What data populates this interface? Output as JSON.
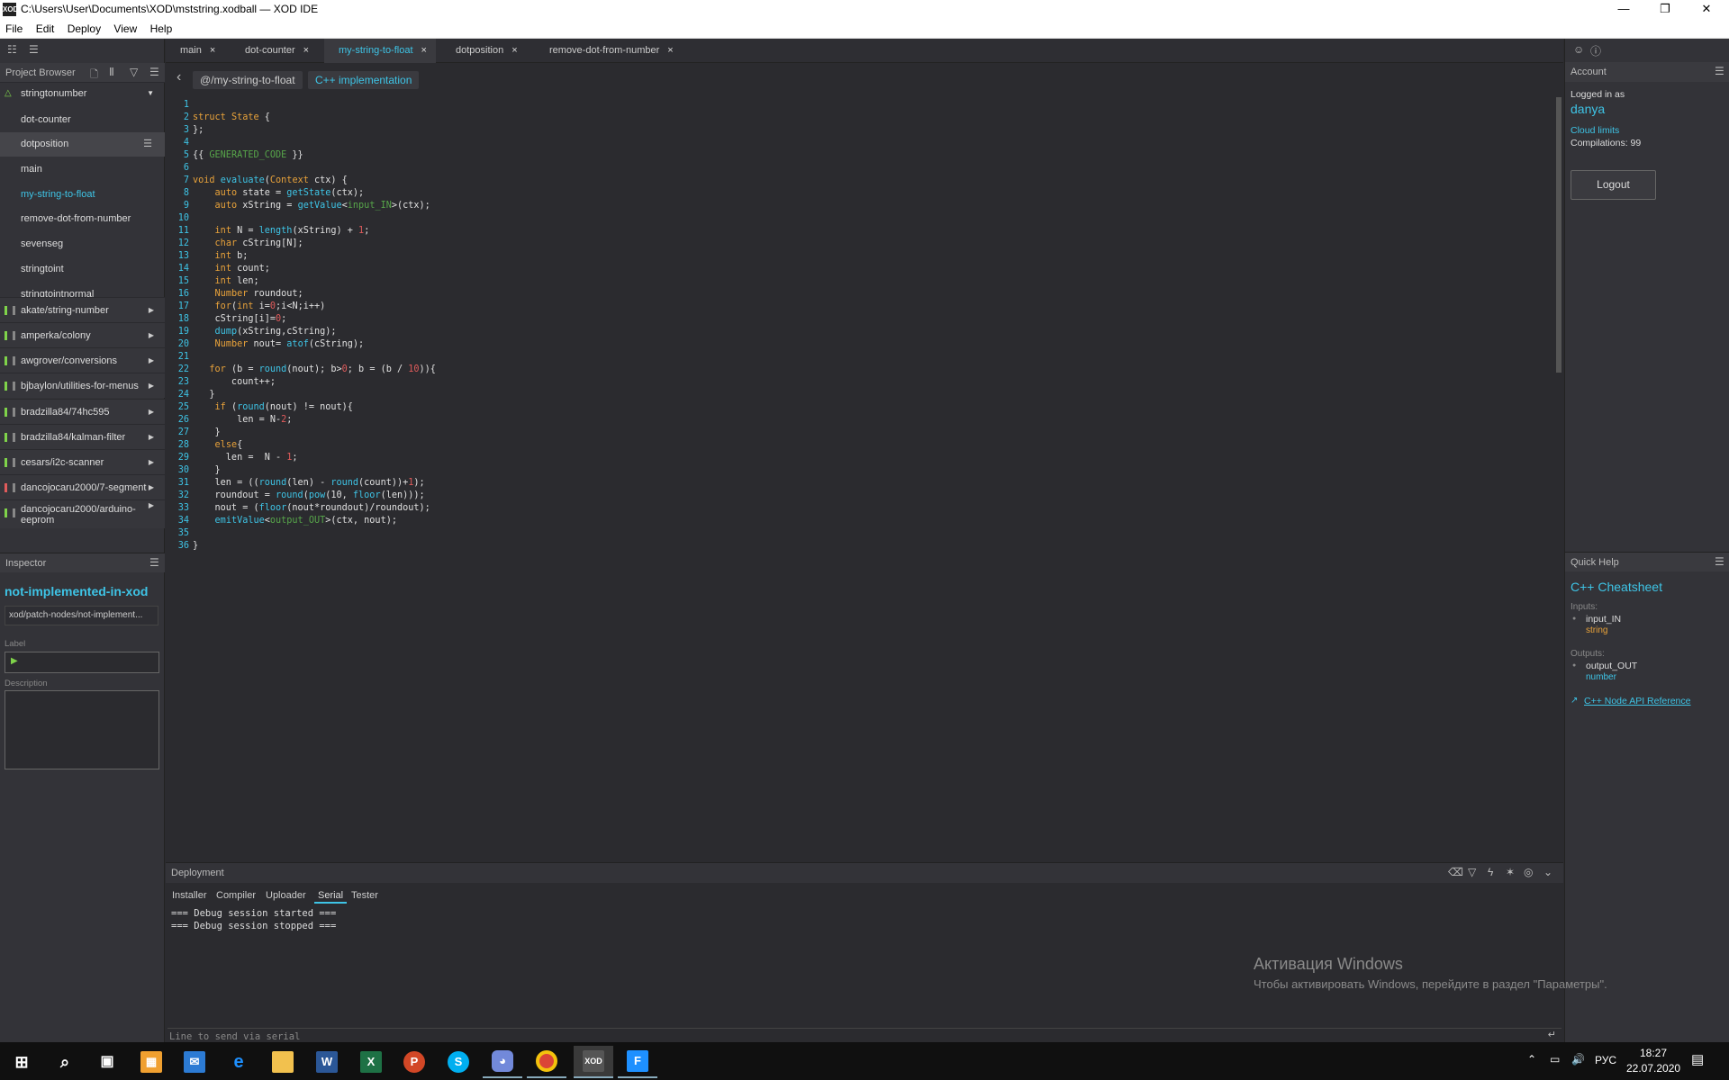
{
  "window": {
    "app_icon": "XOD",
    "title": "C:\\Users\\User\\Documents\\XOD\\mststring.xodball — XOD IDE",
    "controls": [
      "minimize-icon",
      "maximize-icon",
      "close-icon"
    ]
  },
  "menu": [
    "File",
    "Edit",
    "Deploy",
    "View",
    "Help"
  ],
  "project_browser": {
    "header": "Project Browser",
    "project": "stringtonumber",
    "patches": [
      "dot-counter",
      "dotposition",
      "main",
      "my-string-to-float",
      "remove-dot-from-number",
      "sevenseg",
      "stringtoint",
      "stringtointnormal"
    ],
    "selected_patch": "dotposition",
    "active_patch": "my-string-to-float",
    "libraries": [
      "akate/string-number",
      "amperka/colony",
      "awgrover/conversions",
      "bjbaylon/utilities-for-menus",
      "bradzilla84/74hc595",
      "bradzilla84/kalman-filter",
      "cesars/i2c-scanner",
      "dancojocaru2000/7-segment",
      "dancojocaru2000/arduino-eeprom"
    ]
  },
  "inspector": {
    "header": "Inspector",
    "node_title": "not-implemented-in-xod",
    "node_type": "xod/patch-nodes/not-implement...",
    "label_caption": "Label",
    "label_value": "",
    "description_caption": "Description",
    "description_value": ""
  },
  "tabs": [
    {
      "label": "main",
      "close": "×"
    },
    {
      "label": "dot-counter",
      "close": "×"
    },
    {
      "label": "my-string-to-float",
      "close": "×",
      "active": true
    },
    {
      "label": "dotposition",
      "close": "×"
    },
    {
      "label": "remove-dot-from-number",
      "close": "×"
    }
  ],
  "breadcrumbs": [
    "@/my-string-to-float",
    "C++ implementation"
  ],
  "code_lines": [
    "",
    "struct State {",
    "};",
    "",
    "{{ GENERATED_CODE }}",
    "",
    "void evaluate(Context ctx) {",
    "    auto state = getState(ctx);",
    "    auto xString = getValue<input_IN>(ctx);",
    "",
    "    int N = length(xString) + 1;",
    "    char cString[N];",
    "    int b;",
    "    int count;",
    "    int len;",
    "    Number roundout;",
    "    for(int i=0;i<N;i++)",
    "    cString[i]=0;",
    "    dump(xString,cString);",
    "    Number nout= atof(cString);",
    "",
    "   for (b = round(nout); b>0; b = (b / 10)){",
    "       count++;",
    "   }",
    "    if (round(nout) != nout){",
    "        len = N-2;",
    "    }",
    "    else{",
    "      len =  N - 1;",
    "    }",
    "    len = ((round(len) - round(count))+1);",
    "    roundout = round(pow(10, floor(len)));",
    "    nout = (floor(nout*roundout)/roundout);",
    "    emitValue<output_OUT>(ctx, nout);",
    "",
    "}"
  ],
  "account": {
    "header": "Account",
    "logged_in_as": "Logged in as",
    "username": "danya",
    "cloud_limits": "Cloud limits",
    "compilations": "Compilations: 99",
    "logout": "Logout"
  },
  "quick_help": {
    "header": "Quick Help",
    "title": "C++ Cheatsheet",
    "inputs_label": "Inputs:",
    "input_name": "input_IN",
    "input_type": "string",
    "outputs_label": "Outputs:",
    "output_name": "output_OUT",
    "output_type": "number",
    "api_link": "C++ Node API Reference"
  },
  "deployment": {
    "header": "Deployment",
    "tabs": [
      "Installer",
      "Compiler",
      "Uploader",
      "Serial",
      "Tester"
    ],
    "active_tab": "Serial",
    "log": [
      "=== Debug session started ===",
      "=== Debug session stopped ==="
    ],
    "serial_placeholder": "Line to send via serial"
  },
  "watermark": {
    "title": "Активация Windows",
    "subtitle": "Чтобы активировать Windows, перейдите в раздел \"Параметры\"."
  },
  "taskbar": {
    "apps": [
      "windows-start-icon",
      "search-icon",
      "task-view-icon",
      "store-icon",
      "mail-icon",
      "edge-icon",
      "file-explorer-icon",
      "word-icon",
      "excel-icon",
      "powerpoint-icon",
      "skype-icon",
      "discord-icon",
      "chrome-icon",
      "xod-icon",
      "app-f-icon"
    ],
    "language": "РУС",
    "time": "18:27",
    "date": "22.07.2020"
  },
  "colors": {
    "accent": "#3ec4e6",
    "keyword": "#e8a23a",
    "number": "#e05b5b",
    "generated": "#57a64a"
  }
}
